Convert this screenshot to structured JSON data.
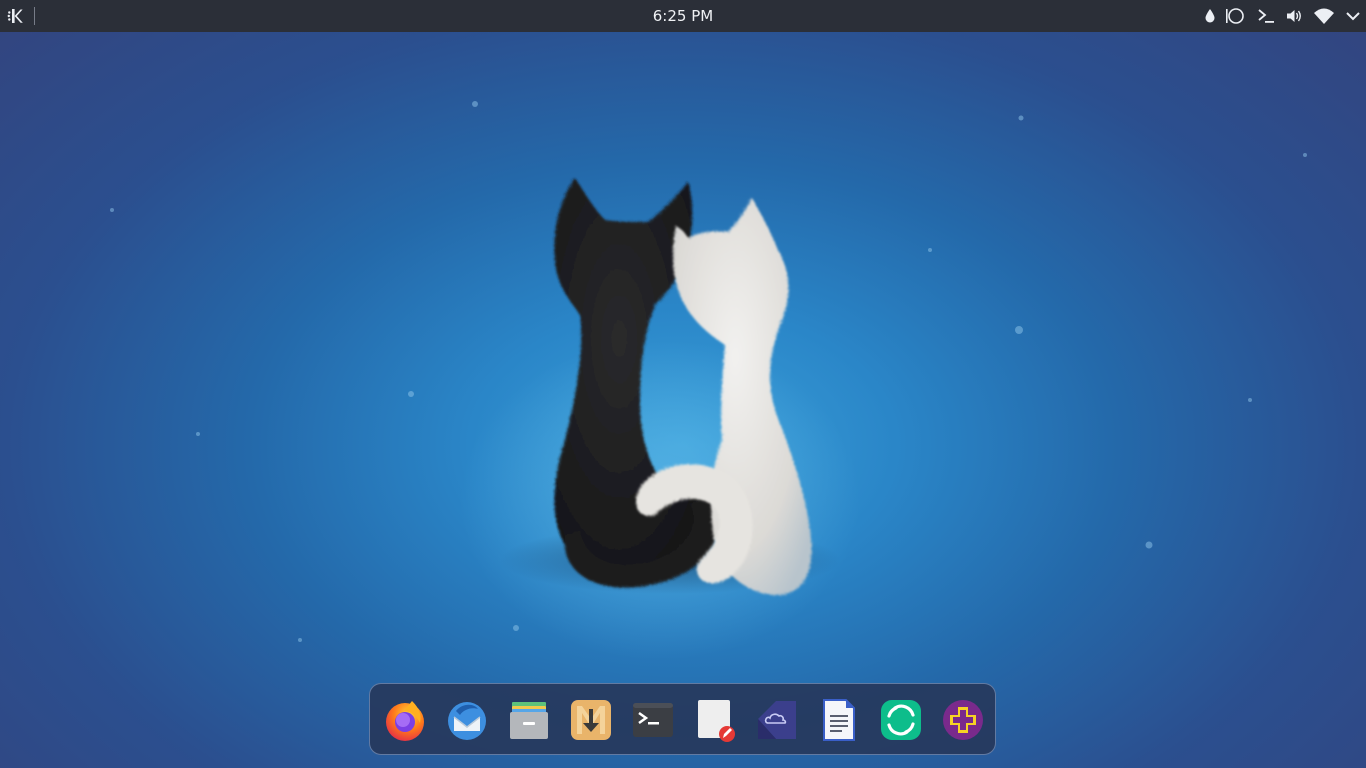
{
  "topbar": {
    "clock": "6:25 PM",
    "launcher_icon": "kde-logo-icon",
    "tray": [
      {
        "name": "ink-drop-icon"
      },
      {
        "name": "status-circle-icon"
      },
      {
        "name": "terminal-prompt-icon"
      },
      {
        "name": "volume-icon"
      },
      {
        "name": "wifi-icon"
      },
      {
        "name": "chevron-down-icon"
      }
    ]
  },
  "wallpaper": {
    "subject": "two-fluffy-cats-icon",
    "colors": {
      "bg_center": "#3a9fd9",
      "bg_edge": "#33447e",
      "black_cat": "#1c1c1e",
      "white_cat": "#e8e6e3"
    }
  },
  "dock": {
    "apps": [
      {
        "name": "firefox-icon"
      },
      {
        "name": "thunderbird-icon"
      },
      {
        "name": "file-manager-icon"
      },
      {
        "name": "downloader-icon"
      },
      {
        "name": "terminal-icon"
      },
      {
        "name": "text-editor-icon"
      },
      {
        "name": "cloud-sync-icon"
      },
      {
        "name": "document-writer-icon"
      },
      {
        "name": "element-chat-icon"
      },
      {
        "name": "plus-app-icon"
      }
    ]
  }
}
